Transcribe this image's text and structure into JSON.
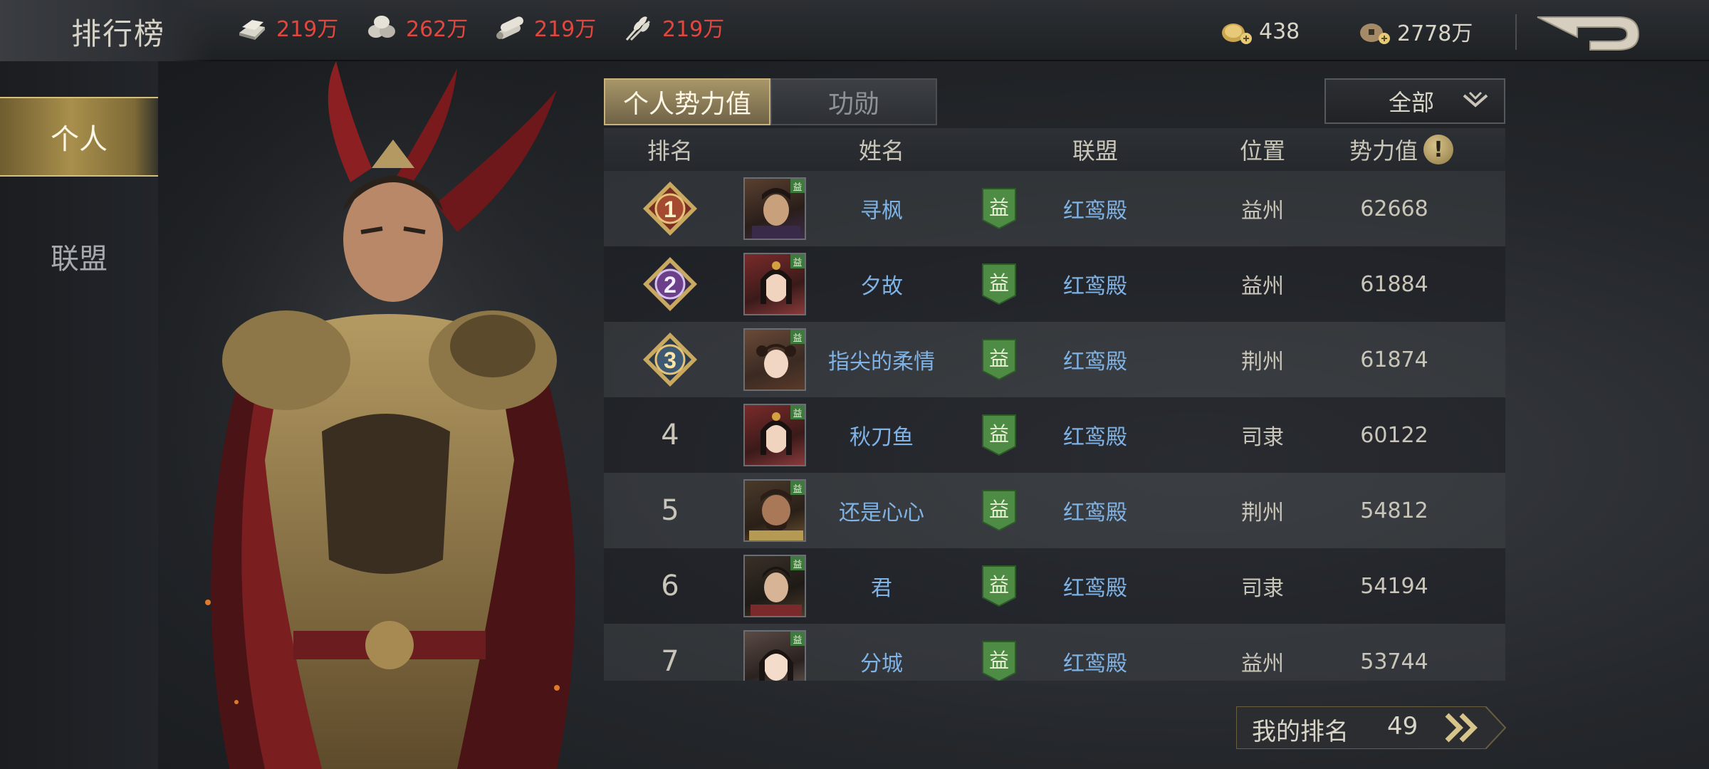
{
  "header": {
    "title": "排行榜",
    "resources": [
      {
        "icon": "iron-ingot-icon",
        "value": "219万"
      },
      {
        "icon": "stone-icon",
        "value": "262万"
      },
      {
        "icon": "wood-icon",
        "value": "219万"
      },
      {
        "icon": "grain-icon",
        "value": "219万"
      }
    ],
    "currencies": [
      {
        "icon": "gold-coin-add-icon",
        "value": "438"
      },
      {
        "icon": "copper-coin-add-icon",
        "value": "2778万"
      }
    ]
  },
  "sidebar": {
    "tabs": [
      {
        "label": "个人",
        "active": true
      },
      {
        "label": "联盟",
        "active": false
      }
    ]
  },
  "panel": {
    "tabs": [
      {
        "label": "个人势力值",
        "active": true
      },
      {
        "label": "功勋",
        "active": false
      }
    ],
    "filter_label": "全部",
    "columns": {
      "rank": "排名",
      "name": "姓名",
      "alliance": "联盟",
      "location": "位置",
      "power": "势力值"
    },
    "rows": [
      {
        "rank": "1",
        "name": "寻枫",
        "region_tag": "益",
        "alliance": "红鸾殿",
        "location": "益州",
        "power": "62668"
      },
      {
        "rank": "2",
        "name": "夕故",
        "region_tag": "益",
        "alliance": "红鸾殿",
        "location": "益州",
        "power": "61884"
      },
      {
        "rank": "3",
        "name": "指尖的柔情",
        "region_tag": "益",
        "alliance": "红鸾殿",
        "location": "荆州",
        "power": "61874"
      },
      {
        "rank": "4",
        "name": "秋刀鱼",
        "region_tag": "益",
        "alliance": "红鸾殿",
        "location": "司隶",
        "power": "60122"
      },
      {
        "rank": "5",
        "name": "还是心心",
        "region_tag": "益",
        "alliance": "红鸾殿",
        "location": "荆州",
        "power": "54812"
      },
      {
        "rank": "6",
        "name": "君",
        "region_tag": "益",
        "alliance": "红鸾殿",
        "location": "司隶",
        "power": "54194"
      },
      {
        "rank": "7",
        "name": "分城",
        "region_tag": "益",
        "alliance": "红鸾殿",
        "location": "益州",
        "power": "53744"
      }
    ],
    "my_rank_label": "我的排名",
    "my_rank_value": "49"
  },
  "colors": {
    "resource_red": "#e2473f",
    "link_blue": "#7fb3e6",
    "gold": "#c8b27a",
    "banner_green": "#4e8b45"
  }
}
